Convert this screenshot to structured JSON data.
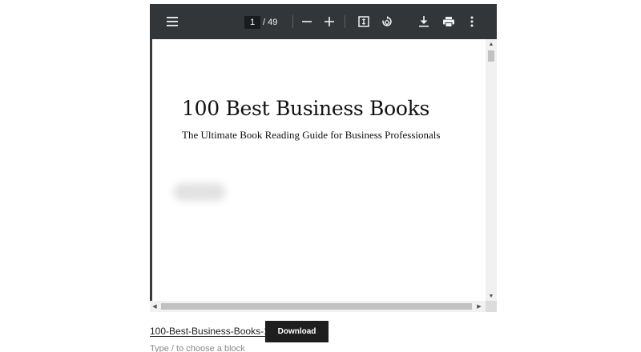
{
  "viewer": {
    "toolbar": {
      "menu_icon": "hamburger-menu-icon",
      "current_page": "1",
      "page_total": "/ 49",
      "zoom_out_icon": "minus-icon",
      "zoom_in_icon": "plus-icon",
      "fit_icon": "fit-to-page-icon",
      "rotate_icon": "rotate-icon",
      "download_icon": "download-icon",
      "print_icon": "print-icon",
      "more_icon": "more-vertical-icon"
    },
    "document": {
      "title": "100 Best Business Books",
      "subtitle": "The Ultimate Book Reading Guide for Business Professionals"
    },
    "scrollbars": {
      "up_arrow": "▲",
      "down_arrow": "▼",
      "left_arrow": "◀",
      "right_arrow": "▶"
    }
  },
  "file": {
    "name": "100-Best-Business-Books-1",
    "download_label": "Download"
  },
  "editor": {
    "block_hint": "Type / to choose a block"
  },
  "colors": {
    "toolbar_bg": "#323639",
    "button_bg": "#1e1e1e"
  }
}
